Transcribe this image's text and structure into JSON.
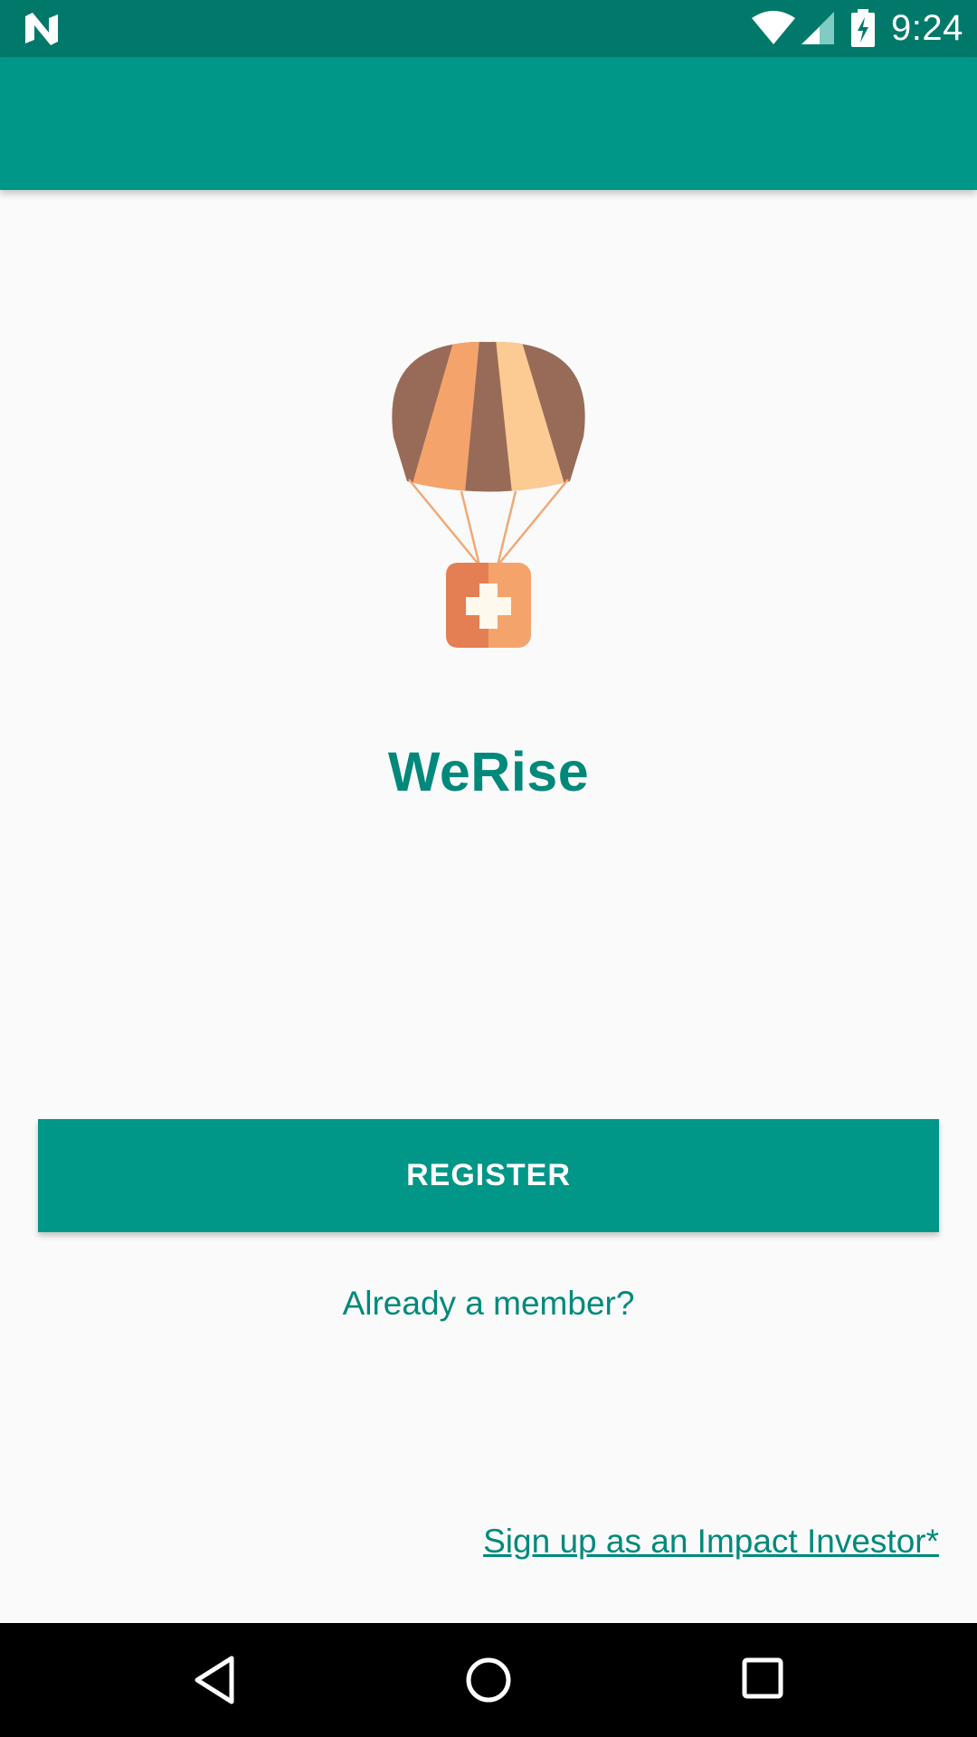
{
  "status_bar": {
    "time": "9:24",
    "icons": [
      "n-notification-icon",
      "wifi-icon",
      "cell-signal-icon",
      "battery-charging-icon"
    ]
  },
  "app": {
    "name": "WeRise",
    "logo": "parachute-medical-kit-logo"
  },
  "actions": {
    "register_label": "REGISTER",
    "member_link": "Already a member?",
    "investor_link": "Sign up as an Impact Investor*"
  },
  "nav_bar": {
    "icons": [
      "back-icon",
      "home-icon",
      "recent-apps-icon"
    ]
  },
  "colors": {
    "status_bar": "#00796b",
    "primary": "#009688",
    "primary_text": "#00897b",
    "background": "#fafafa"
  }
}
